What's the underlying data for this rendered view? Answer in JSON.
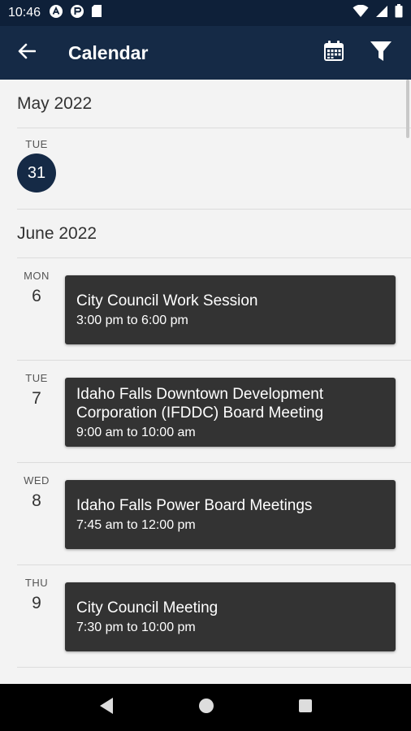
{
  "status_bar": {
    "time": "10:46"
  },
  "app_bar": {
    "title": "Calendar",
    "back_icon": "arrow-left-icon",
    "calendar_icon": "calendar-icon",
    "filter_icon": "filter-icon"
  },
  "months": [
    {
      "label": "May 2022",
      "days": [
        {
          "dow": "TUE",
          "dom": "31",
          "today": true,
          "events": []
        }
      ]
    },
    {
      "label": "June 2022",
      "days": [
        {
          "dow": "MON",
          "dom": "6",
          "events": [
            {
              "title": "City Council Work Session",
              "time": "3:00 pm to 6:00 pm"
            }
          ]
        },
        {
          "dow": "TUE",
          "dom": "7",
          "events": [
            {
              "title": "Idaho Falls Downtown Development Corporation (IFDDC) Board Meeting",
              "time": "9:00 am to 10:00 am"
            }
          ]
        },
        {
          "dow": "WED",
          "dom": "8",
          "events": [
            {
              "title": "Idaho Falls Power Board Meetings",
              "time": "7:45 am to 12:00 pm"
            }
          ]
        },
        {
          "dow": "THU",
          "dom": "9",
          "events": [
            {
              "title": "City Council Meeting",
              "time": "7:30 pm to 10:00 pm"
            }
          ]
        }
      ]
    }
  ],
  "colors": {
    "header_bg": "#152a46",
    "status_bg": "#0e2039",
    "card_bg": "#333333",
    "page_bg": "#f3f3f3"
  }
}
